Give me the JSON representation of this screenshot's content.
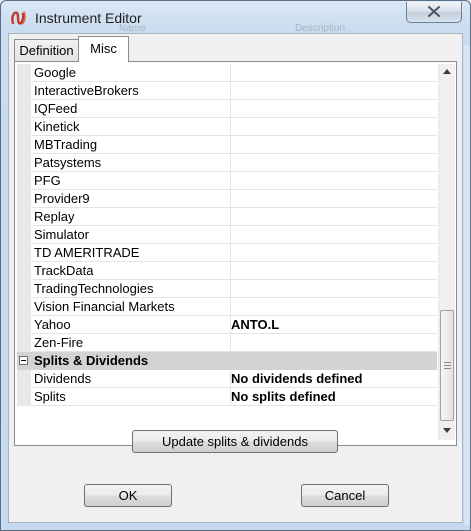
{
  "window": {
    "title": "Instrument Editor",
    "background_ghost": [
      "Name",
      "Description"
    ]
  },
  "tabs": [
    {
      "label": "Definition",
      "active": false
    },
    {
      "label": "Misc",
      "active": true
    }
  ],
  "grid": {
    "rows": [
      {
        "name": "Google",
        "value": ""
      },
      {
        "name": "InteractiveBrokers",
        "value": ""
      },
      {
        "name": "IQFeed",
        "value": ""
      },
      {
        "name": "Kinetick",
        "value": ""
      },
      {
        "name": "MBTrading",
        "value": ""
      },
      {
        "name": "Patsystems",
        "value": ""
      },
      {
        "name": "PFG",
        "value": ""
      },
      {
        "name": "Provider9",
        "value": ""
      },
      {
        "name": "Replay",
        "value": ""
      },
      {
        "name": "Simulator",
        "value": ""
      },
      {
        "name": "TD AMERITRADE",
        "value": ""
      },
      {
        "name": "TrackData",
        "value": ""
      },
      {
        "name": "TradingTechnologies",
        "value": ""
      },
      {
        "name": "Vision Financial Markets",
        "value": ""
      },
      {
        "name": "Yahoo",
        "value": "ANTO.L"
      },
      {
        "name": "Zen-Fire",
        "value": ""
      }
    ],
    "category": {
      "label": "Splits & Dividends",
      "expanded": true
    },
    "category_rows": [
      {
        "name": "Dividends",
        "value": "No dividends defined"
      },
      {
        "name": "Splits",
        "value": "No splits defined"
      }
    ]
  },
  "buttons": {
    "update": "Update splits & dividends",
    "ok": "OK",
    "cancel": "Cancel"
  },
  "icons": {
    "app": "ninjatrader-logo-icon",
    "close": "close-icon",
    "collapse": "collapse-icon",
    "scroll_up": "arrow-up-icon",
    "scroll_down": "arrow-down-icon"
  },
  "colors": {
    "titlebar": "#c9dcf0",
    "category_row": "#d3d3d3",
    "logo": "#c0392b"
  }
}
